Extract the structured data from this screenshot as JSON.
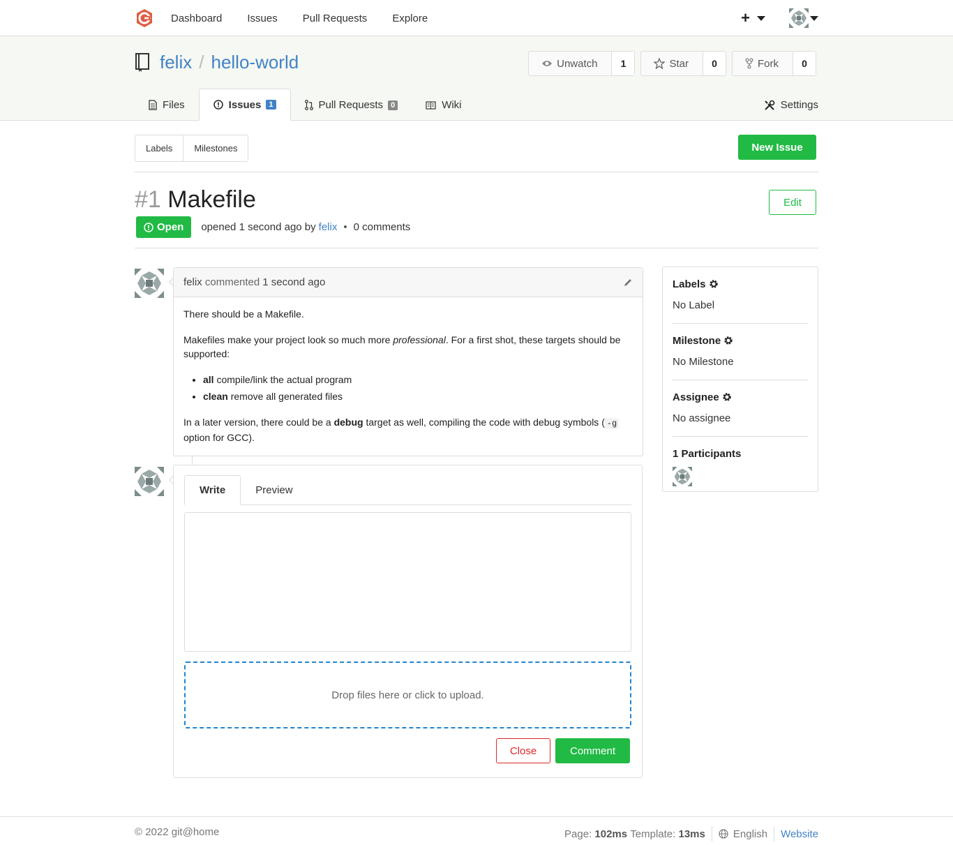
{
  "topnav": {
    "items": [
      {
        "label": "Dashboard"
      },
      {
        "label": "Issues"
      },
      {
        "label": "Pull Requests"
      },
      {
        "label": "Explore"
      }
    ],
    "plus_label": "+"
  },
  "repo": {
    "owner": "felix",
    "separator": "/",
    "name": "hello-world",
    "watch": {
      "label": "Unwatch",
      "count": "1"
    },
    "star": {
      "label": "Star",
      "count": "0"
    },
    "fork": {
      "label": "Fork",
      "count": "0"
    },
    "tabs": [
      {
        "label": "Files"
      },
      {
        "label": "Issues",
        "badge": "1"
      },
      {
        "label": "Pull Requests",
        "badge": "0"
      },
      {
        "label": "Wiki"
      }
    ],
    "settings_label": "Settings"
  },
  "issue_nav": {
    "labels": "Labels",
    "milestones": "Milestones",
    "new_issue": "New Issue"
  },
  "issue": {
    "number": "#1",
    "title": "Makefile",
    "edit": "Edit",
    "status": "Open",
    "opened_text": "opened 1 second ago by",
    "author": "felix",
    "dot": "•",
    "comments": "0 comments"
  },
  "comment": {
    "user": "felix",
    "action": "commented",
    "time": "1 second ago",
    "p1": "There should be a Makefile.",
    "p2_a": "Makefiles make your project look so much more ",
    "p2_em": "professional",
    "p2_b": ". For a first shot, these targets should be supported:",
    "li1_b": "all",
    "li1": " compile/link the actual program",
    "li2_b": "clean",
    "li2": " remove all generated files",
    "p3_a": "In a later version, there could be a ",
    "p3_b": "debug",
    "p3_c": " target as well, compiling the code with debug symbols (",
    "p3_code": "-g",
    "p3_d": " option for GCC)."
  },
  "form": {
    "write": "Write",
    "preview": "Preview",
    "textarea_value": "",
    "dropzone": "Drop files here or click to upload.",
    "close": "Close",
    "comment": "Comment"
  },
  "sidebar": {
    "labels_h": "Labels",
    "labels_v": "No Label",
    "milestone_h": "Milestone",
    "milestone_v": "No Milestone",
    "assignee_h": "Assignee",
    "assignee_v": "No assignee",
    "participants_h": "1 Participants"
  },
  "footer": {
    "copyright": "© 2022 git@home",
    "page_label": "Page:",
    "page_time": "102ms",
    "template_label": "Template:",
    "template_time": "13ms",
    "language": "English",
    "website": "Website"
  },
  "colors": {
    "accent": "#4183c4",
    "green": "#21ba45",
    "red": "#db2828",
    "logo": "#e05d44"
  }
}
